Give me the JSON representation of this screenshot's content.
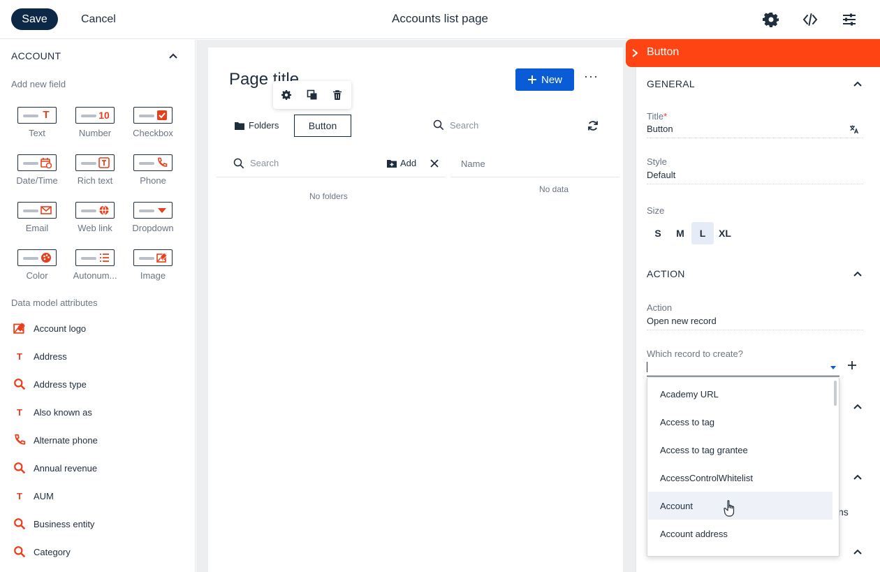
{
  "topbar": {
    "save_label": "Save",
    "cancel_label": "Cancel",
    "title": "Accounts list page"
  },
  "left": {
    "section_title": "ACCOUNT",
    "add_field_label": "Add new field",
    "fields": [
      {
        "label": "Text",
        "icon": "text-icon"
      },
      {
        "label": "Number",
        "icon": "number-icon"
      },
      {
        "label": "Checkbox",
        "icon": "checkbox-icon"
      },
      {
        "label": "Date/Time",
        "icon": "datetime-icon"
      },
      {
        "label": "Rich text",
        "icon": "richtext-icon"
      },
      {
        "label": "Phone",
        "icon": "phone-icon"
      },
      {
        "label": "Email",
        "icon": "email-icon"
      },
      {
        "label": "Web link",
        "icon": "globe-icon"
      },
      {
        "label": "Dropdown",
        "icon": "dropdown-icon"
      },
      {
        "label": "Color",
        "icon": "color-icon"
      },
      {
        "label": "Autonum...",
        "icon": "autonumber-icon"
      },
      {
        "label": "Image",
        "icon": "image-icon"
      }
    ],
    "attrs_label": "Data model attributes",
    "attributes": [
      {
        "label": "Account logo",
        "icon": "image-icon"
      },
      {
        "label": "Address",
        "icon": "text-icon"
      },
      {
        "label": "Address type",
        "icon": "lookup-icon"
      },
      {
        "label": "Also known as",
        "icon": "text-icon"
      },
      {
        "label": "Alternate phone",
        "icon": "phone-icon"
      },
      {
        "label": "Annual revenue",
        "icon": "lookup-icon"
      },
      {
        "label": "AUM",
        "icon": "text-icon"
      },
      {
        "label": "Business entity",
        "icon": "lookup-icon"
      },
      {
        "label": "Category",
        "icon": "lookup-icon"
      }
    ]
  },
  "canvas": {
    "page_title": "Page title",
    "new_label": "New",
    "folders_label": "Folders",
    "button_label": "Button",
    "search_placeholder": "Search",
    "folder_search_placeholder": "Search",
    "add_label": "Add",
    "name_col": "Name",
    "no_folders": "No folders",
    "no_data": "No data"
  },
  "right": {
    "header_title": "Button",
    "general_label": "GENERAL",
    "title_label": "Title",
    "title_value": "Button",
    "style_label": "Style",
    "style_value": "Default",
    "size_label": "Size",
    "sizes": [
      "S",
      "M",
      "L",
      "XL"
    ],
    "size_selected": "L",
    "action_section": "ACTION",
    "action_label": "Action",
    "action_value": "Open new record",
    "which_record_label": "Which record to create?",
    "ghost_text": "ns",
    "dropdown_items": [
      "Academy URL",
      "Access to tag",
      "Access to tag grantee",
      "AccessControlWhitelist",
      "Account",
      "Account address"
    ],
    "hovered_item": "Account"
  },
  "colors": {
    "accent": "#ff4413",
    "primary_button": "#0a5bd6",
    "save_button": "#0d2847",
    "icon_red": "#e8401c"
  }
}
